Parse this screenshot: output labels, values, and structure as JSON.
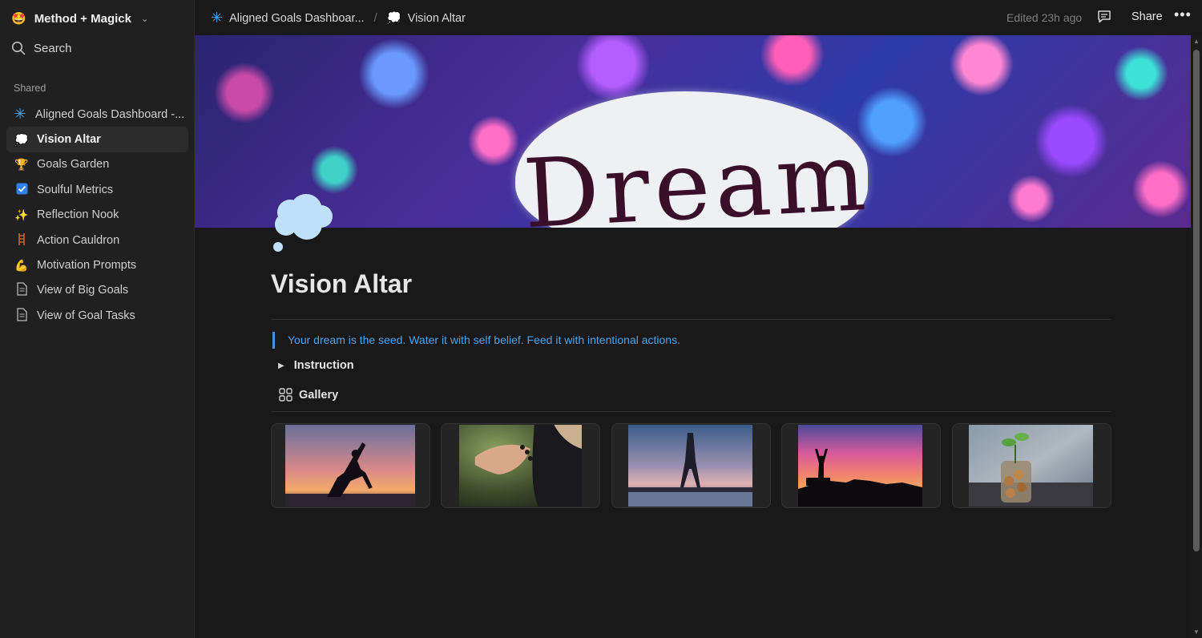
{
  "workspace": {
    "emoji": "🤩",
    "name": "Method + Magick"
  },
  "search": {
    "label": "Search"
  },
  "sidebar": {
    "section_label": "Shared",
    "items": [
      {
        "icon": "asterisk-icon",
        "label": "Aligned Goals Dashboard -..."
      },
      {
        "icon": "thought-bubble-icon",
        "label": "Vision Altar",
        "active": true
      },
      {
        "icon": "trophy-icon",
        "label": "Goals Garden"
      },
      {
        "icon": "checkbox-icon",
        "label": "Soulful Metrics"
      },
      {
        "icon": "sparkles-icon",
        "label": "Reflection Nook"
      },
      {
        "icon": "ladder-icon",
        "label": "Action Cauldron"
      },
      {
        "icon": "flexed-biceps-icon",
        "label": "Motivation Prompts"
      },
      {
        "icon": "document-icon",
        "label": "View of Big Goals"
      },
      {
        "icon": "document-icon",
        "label": "View of Goal Tasks"
      }
    ]
  },
  "topbar": {
    "breadcrumbs": [
      "Aligned Goals Dashboar...",
      "Vision Altar"
    ],
    "separator": "/",
    "edited": "Edited 23h ago",
    "share_label": "Share",
    "more_label": "•••"
  },
  "cover": {
    "text": "Dream"
  },
  "page": {
    "title": "Vision Altar",
    "quote": "Your dream is the seed. Water it with self belief. Feed it with intentional actions.",
    "toggle_label": "Instruction",
    "gallery_label": "Gallery"
  },
  "gallery": [
    {
      "image": "yoga-silhouette-sunset"
    },
    {
      "image": "meditation-hand"
    },
    {
      "image": "eiffel-tower-dusk"
    },
    {
      "image": "person-arms-raised-sunset"
    },
    {
      "image": "plant-in-coin-jar"
    }
  ],
  "colors": {
    "accent_blue": "#4aa3ea",
    "quote_bar": "#4b8fd6",
    "background": "#191919",
    "sidebar": "#202020"
  }
}
